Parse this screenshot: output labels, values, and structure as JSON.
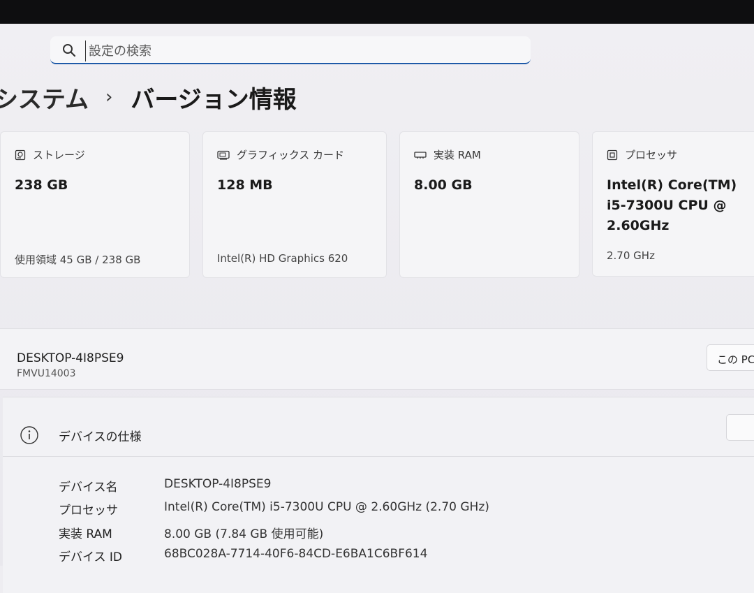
{
  "search": {
    "placeholder": "設定の検索"
  },
  "breadcrumb": {
    "parent": "システム",
    "separator": "›",
    "current": "バージョン情報"
  },
  "cards": [
    {
      "title": "ストレージ",
      "value": "238 GB",
      "sub": "使用領域 45 GB / 238 GB"
    },
    {
      "title": "グラフィックス カード",
      "value": "128 MB",
      "sub": "Intel(R) HD Graphics 620"
    },
    {
      "title": "実装 RAM",
      "value": "8.00 GB",
      "sub": ""
    },
    {
      "title": "プロセッサ",
      "value_lines": [
        "Intel(R) Core(TM)",
        "i5-7300U CPU @",
        "2.60GHz"
      ],
      "sub": "2.70 GHz"
    }
  ],
  "device": {
    "name": "DESKTOP-4I8PSE9",
    "model": "FMVU14003",
    "rename_label": "この PC"
  },
  "specs": {
    "title": "デバイスの仕様",
    "rows": [
      {
        "label": "デバイス名",
        "value": "DESKTOP-4I8PSE9"
      },
      {
        "label": "プロセッサ",
        "value": "Intel(R) Core(TM) i5-7300U CPU @ 2.60GHz (2.70 GHz)"
      },
      {
        "label": "実装 RAM",
        "value": "8.00 GB (7.84 GB 使用可能)"
      },
      {
        "label": "デバイス ID",
        "value": "68BC028A-7714-40F6-84CD-E6BA1C6BF614"
      }
    ]
  },
  "colors": {
    "accent": "#1f5aa8",
    "background": "#eeedf1",
    "card": "#f5f5f7"
  },
  "icons": {
    "search": "search-icon",
    "storage": "storage-icon",
    "graphics": "graphics-card-icon",
    "ram": "ram-icon",
    "processor": "processor-icon",
    "info": "info-icon"
  }
}
